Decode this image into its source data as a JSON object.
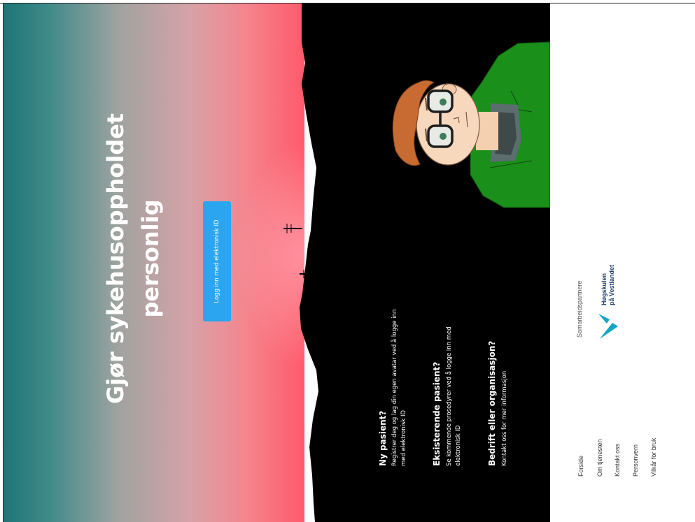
{
  "hero": {
    "title": "Gjør sykehusoppholdet personlig",
    "login_button": "Logg inn med elektronisk ID"
  },
  "info": [
    {
      "heading": "Ny pasient?",
      "text_1": "Registrer deg og lag din egen avatar ved å logge inn",
      "text_2": "med elektronisk ID"
    },
    {
      "heading": "Eksisterende pasient?",
      "text_1": "Se kommende prosedyrer ved å logge inn med",
      "text_2": "elektronisk ID"
    },
    {
      "heading": "Bedrift eller organisasjon?",
      "text_1": "Kontakt oss for mer informasjon"
    }
  ],
  "footer": {
    "links": [
      "Forside",
      "Om tjenesten",
      "Kontakt oss",
      "Personvern",
      "Vilkår for bruk"
    ],
    "partners_label": "Samarbeidspartnere",
    "partner_logo_line1": "Høgskulen",
    "partner_logo_line2": "på Vestlandet"
  },
  "colors": {
    "button": "#2ba5ef",
    "land": "#000000",
    "shirt": "#1a8a1a",
    "partner_logo": "#14a6c8"
  }
}
